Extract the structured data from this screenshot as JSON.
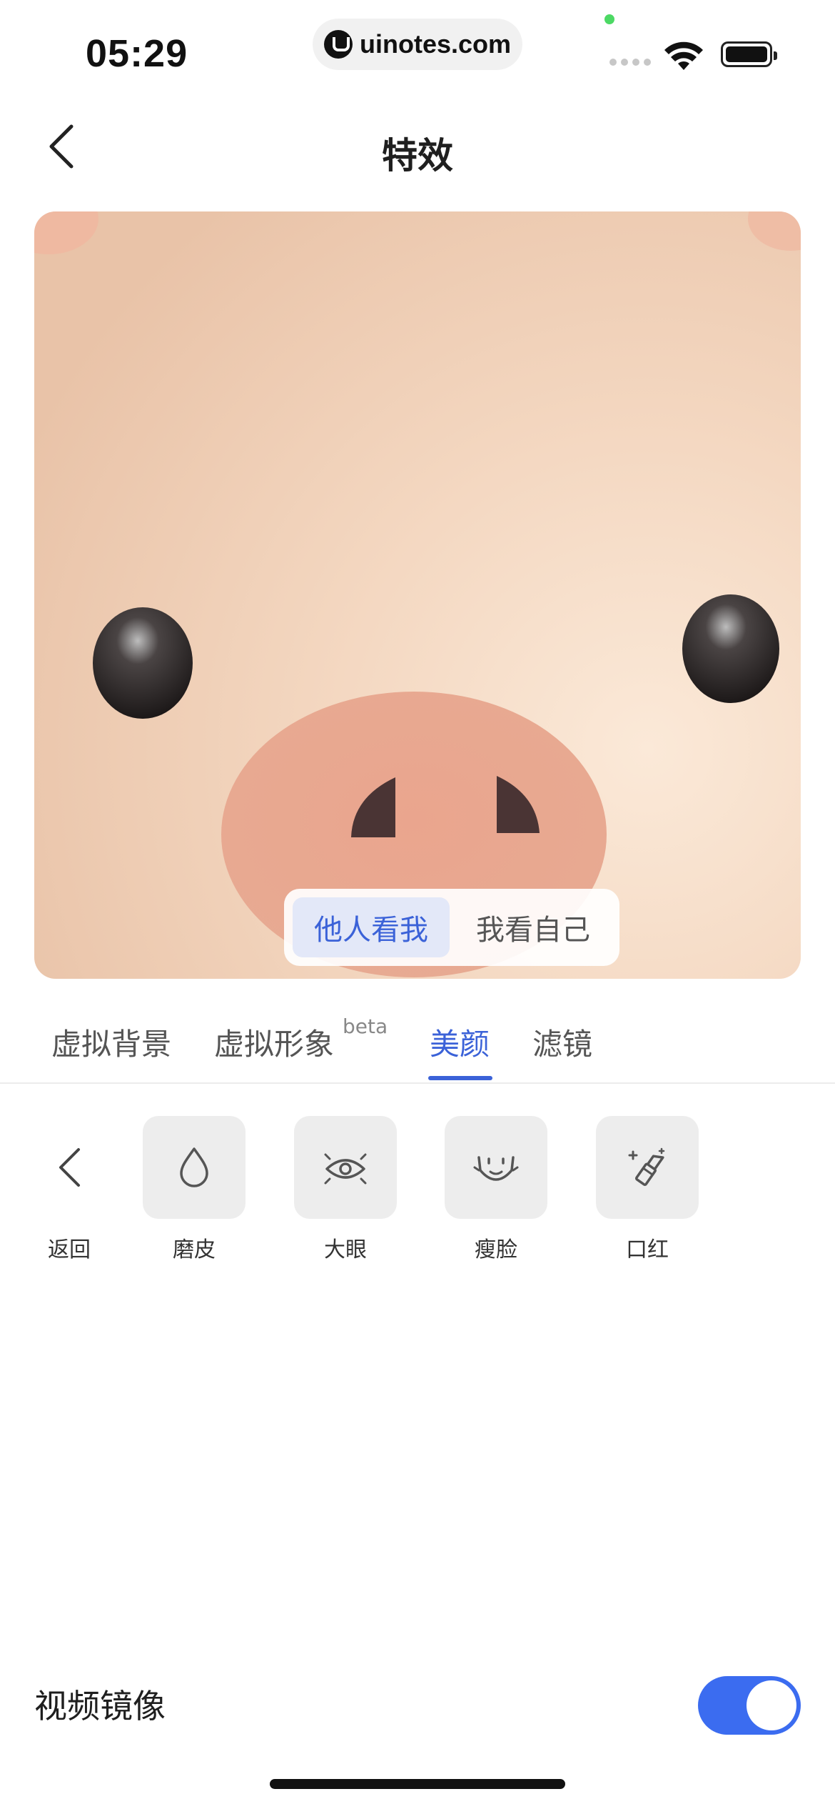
{
  "status_bar": {
    "time": "05:29",
    "url": "uinotes.com"
  },
  "nav": {
    "title": "特效",
    "back_icon": "chevron-left-icon"
  },
  "preview": {
    "toggle_options": [
      {
        "label": "他人看我",
        "selected": true
      },
      {
        "label": "我看自己",
        "selected": false
      }
    ]
  },
  "tabs": {
    "items": [
      {
        "label": "虚拟背景",
        "active": false
      },
      {
        "label": "虚拟形象",
        "active": false
      },
      {
        "label": "美颜",
        "active": true
      },
      {
        "label": "滤镜",
        "active": false
      }
    ],
    "beta_label": "beta"
  },
  "tools": {
    "back_label": "返回",
    "items": [
      {
        "label": "磨皮",
        "icon": "droplet-icon"
      },
      {
        "label": "大眼",
        "icon": "eye-icon"
      },
      {
        "label": "瘦脸",
        "icon": "face-slim-icon"
      },
      {
        "label": "口红",
        "icon": "lipstick-icon"
      }
    ]
  },
  "settings": {
    "mirror_label": "视频镜像",
    "mirror_enabled": true
  },
  "colors": {
    "accent": "#3b62d8",
    "toggle_on": "#3b6cf0"
  }
}
